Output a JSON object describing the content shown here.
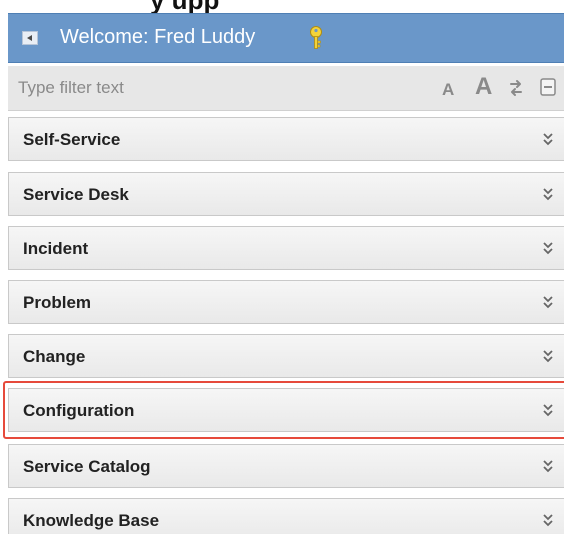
{
  "top_text": "y   upp",
  "header": {
    "welcome_text": "Welcome: Fred Luddy",
    "collapse_icon": "triangle-left-icon",
    "user_icon": "key-icon",
    "background_color": "#6a97c9"
  },
  "filter": {
    "placeholder": "Type filter text",
    "value": "",
    "font_small_label": "A",
    "font_large_label": "A",
    "refresh_icon": "refresh-icon",
    "collapse_all_icon": "collapse-all-icon"
  },
  "menu": {
    "items": [
      {
        "label": "Self-Service",
        "icon": "chevron-double-down-icon"
      },
      {
        "label": "Service Desk",
        "icon": "chevron-double-down-icon"
      },
      {
        "label": "Incident",
        "icon": "chevron-double-down-icon"
      },
      {
        "label": "Problem",
        "icon": "chevron-double-down-icon"
      },
      {
        "label": "Change",
        "icon": "chevron-double-down-icon"
      },
      {
        "label": "Configuration",
        "icon": "chevron-double-down-icon",
        "highlighted": true
      },
      {
        "label": "Service Catalog",
        "icon": "chevron-double-down-icon"
      },
      {
        "label": "Knowledge Base",
        "icon": "chevron-double-down-icon"
      }
    ],
    "highlight_color": "#e64a3b"
  }
}
